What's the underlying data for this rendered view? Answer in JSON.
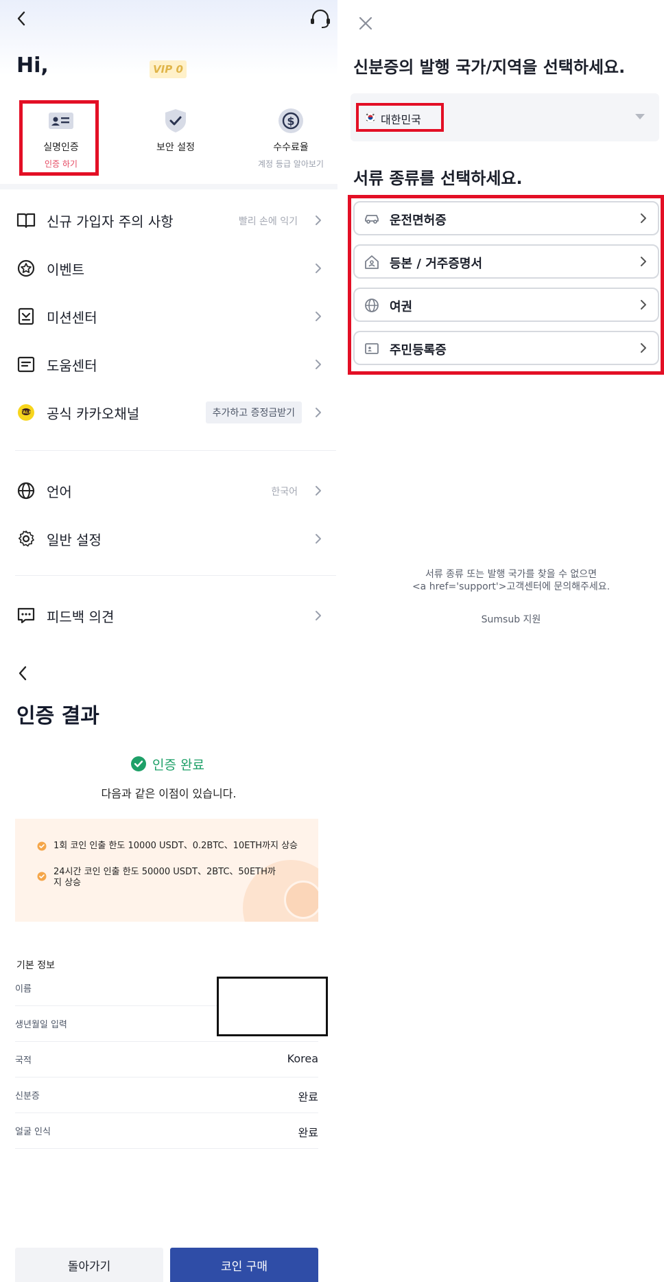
{
  "profile": {
    "greeting": "Hi,",
    "vip_badge": "VIP 0",
    "quick": [
      {
        "label": "실명인증",
        "sub": "인증 하기",
        "icon": "id-card-icon"
      },
      {
        "label": "보안 설정",
        "sub": "",
        "icon": "shield-check-icon"
      },
      {
        "label": "수수료율",
        "sub": "계정 등급 알아보기",
        "icon": "fee-coin-icon"
      }
    ],
    "menu": [
      {
        "label": "신규 가입자 주의 사항",
        "right": "빨리 손에 익기",
        "icon": "book-icon"
      },
      {
        "label": "이벤트",
        "right": "",
        "icon": "star-badge-icon"
      },
      {
        "label": "미션센터",
        "right": "",
        "icon": "mission-icon"
      },
      {
        "label": "도움센터",
        "right": "",
        "icon": "help-doc-icon"
      },
      {
        "label": "공식 카카오채널",
        "right": "추가하고 증정금받기",
        "icon": "kakao-icon"
      },
      {
        "label": "언어",
        "right": "한국어",
        "icon": "globe-icon"
      },
      {
        "label": "일반 설정",
        "right": "",
        "icon": "gear-icon"
      },
      {
        "label": "피드백 의견",
        "right": "",
        "icon": "feedback-icon"
      }
    ]
  },
  "doc_select": {
    "title": "신분증의 발행 국가/지역을 선택하세요.",
    "country": "대한민국",
    "subtitle": "서류 종류를 선택하세요.",
    "docs": [
      {
        "label": "운전면허증",
        "icon": "car-icon"
      },
      {
        "label": "등본 / 거주증명서",
        "icon": "house-icon"
      },
      {
        "label": "여권",
        "icon": "globe-icon"
      },
      {
        "label": "주민등록증",
        "icon": "id-card-icon"
      }
    ],
    "footer_line1": "서류 종류 또는 발행 국가를 찾을 수 없으면",
    "footer_line2": "<a href='support'>고객센터에 문의해주세요.",
    "footer_brand": "Sumsub 지원"
  },
  "result": {
    "title": "인증 결과",
    "status": "인증 완료",
    "benefit_heading": "다음과 같은 이점이 있습니다.",
    "benefits": [
      "1회 코인 인출 한도 10000 USDT、0.2BTC、10ETH까지 상승",
      "24시간 코인 인출 한도 50000 USDT、2BTC、50ETH까지 상승"
    ],
    "info_heading": "기본 정보",
    "info": [
      {
        "key": "이름",
        "value": ""
      },
      {
        "key": "생년월일 입력",
        "value": ""
      },
      {
        "key": "국적",
        "value": "Korea"
      },
      {
        "key": "신분증",
        "value": "완료"
      },
      {
        "key": "얼굴 인식",
        "value": "완료"
      }
    ],
    "btn_back": "돌아가기",
    "btn_buy": "코인 구매"
  },
  "colors": {
    "highlight": "#e30f25",
    "primary": "#2f4da7",
    "success": "#1ea068",
    "benefit_bg": "#fff3ea"
  }
}
